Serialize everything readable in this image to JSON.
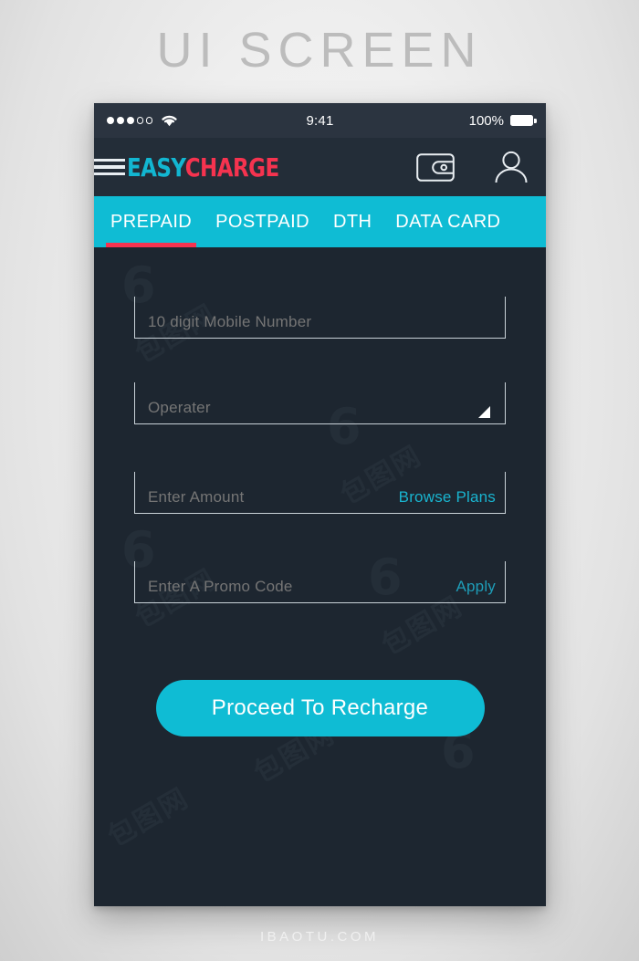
{
  "poster": {
    "title": "UI SCREEN",
    "footer": "IBAOTU.COM",
    "watermark_logo": "6",
    "watermark_text": "包图网"
  },
  "colors": {
    "accent_cyan": "#0fbcd4",
    "accent_red": "#f5334f",
    "screen_bg": "#1d2630",
    "appbar_bg": "#232d38",
    "statusbar_bg": "#2b3440",
    "field_border": "#c9d2d8",
    "placeholder": "#9aa6b0"
  },
  "statusbar": {
    "signal_filled": 3,
    "signal_total": 5,
    "wifi_icon": "wifi-icon",
    "time": "9:41",
    "battery_percent": "100%",
    "battery_icon": "battery-full-icon"
  },
  "appbar": {
    "menu_icon": "hamburger-menu-icon",
    "logo_part1": "EASY",
    "logo_part2": "CHARGE",
    "wallet_icon": "wallet-icon",
    "profile_icon": "user-profile-icon"
  },
  "tabs": [
    {
      "label": "PREPAID",
      "active": true
    },
    {
      "label": "POSTPAID",
      "active": false
    },
    {
      "label": "DTH",
      "active": false
    },
    {
      "label": "DATA CARD",
      "active": false
    }
  ],
  "form": {
    "mobile": {
      "placeholder": "10 digit Mobile Number",
      "value": ""
    },
    "operator": {
      "placeholder": "Operater",
      "value": "",
      "caret_icon": "dropdown-caret-icon"
    },
    "amount": {
      "placeholder": "Enter Amount",
      "value": "",
      "action_label": "Browse Plans"
    },
    "promo": {
      "placeholder": "Enter A Promo Code",
      "value": "",
      "action_label": "Apply"
    },
    "submit_label": "Proceed To Recharge"
  }
}
